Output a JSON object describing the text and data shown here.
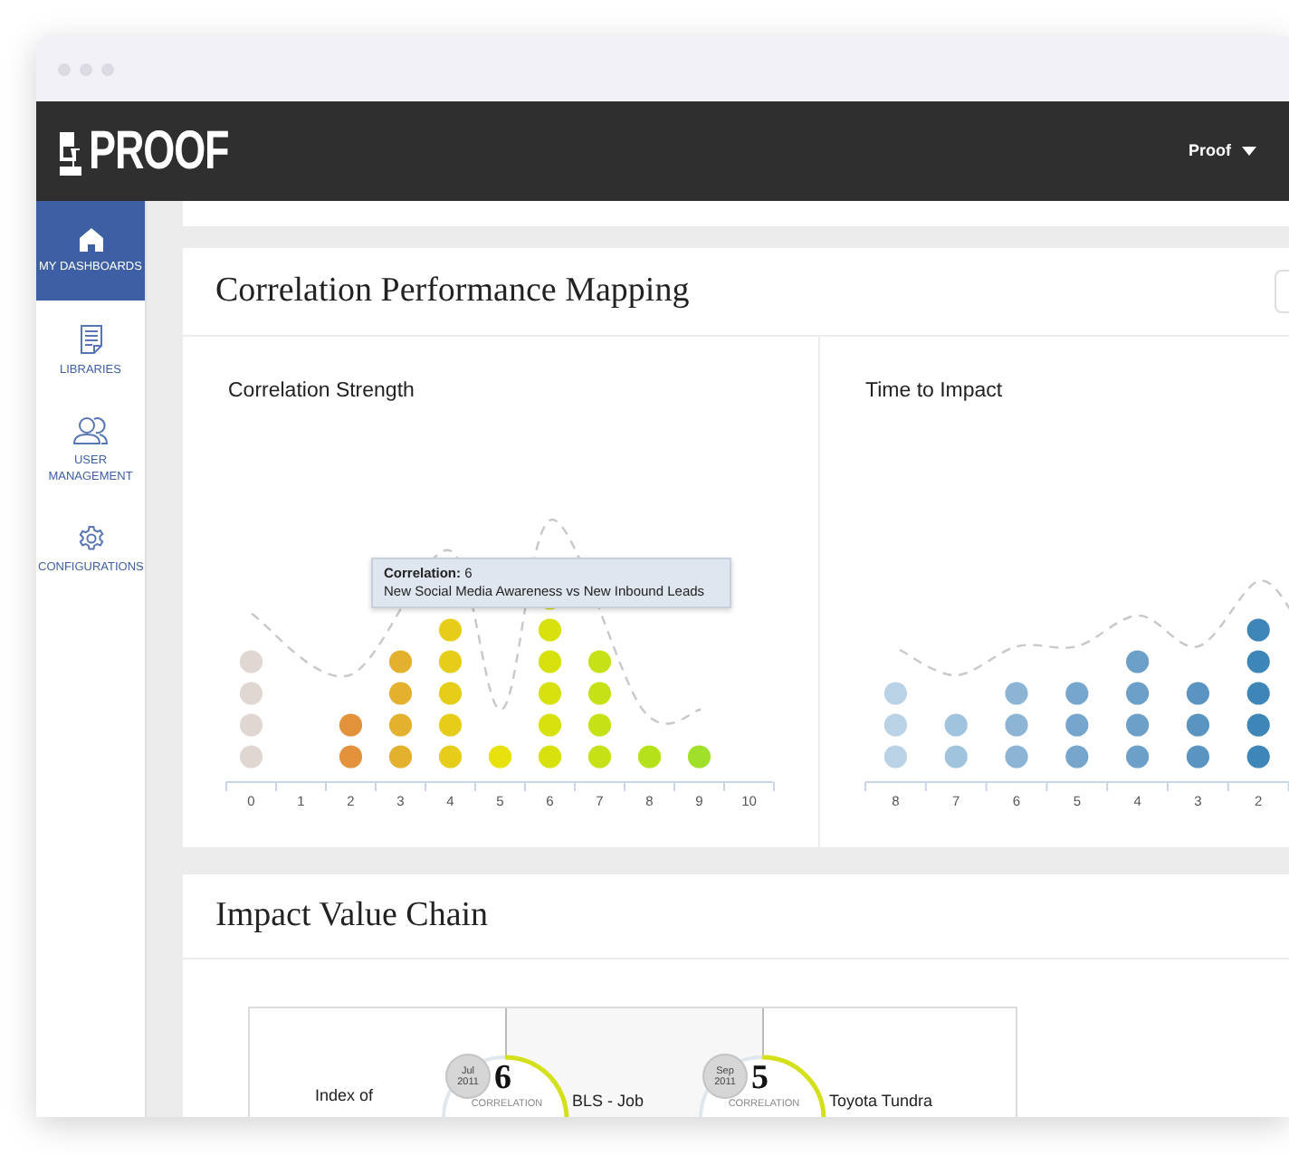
{
  "header": {
    "logo": "PROOF",
    "user_menu": "Proof"
  },
  "sidebar": {
    "items": [
      {
        "kind": "home",
        "label": "MY DASHBOARDS",
        "selected": true
      },
      {
        "kind": "document",
        "label": "LIBRARIES",
        "selected": false
      },
      {
        "kind": "users",
        "label": "USER MANAGEMENT",
        "selected": false
      },
      {
        "kind": "gear",
        "label": "CONFIGURATIONS",
        "selected": false
      }
    ]
  },
  "performance_card": {
    "title": "Correlation Performance Mapping",
    "panels": [
      {
        "title": "Correlation Strength",
        "axis_labels": [
          "0",
          "1",
          "2",
          "3",
          "4",
          "5",
          "6",
          "7",
          "8",
          "9",
          "10"
        ],
        "tooltip": {
          "title": "**Correlation:** 6",
          "text": "New Social Media Awareness vs New Inbound Leads"
        }
      },
      {
        "title": "Time to Impact",
        "axis_labels": [
          "8",
          "7",
          "6",
          "5",
          "4",
          "3",
          "2"
        ]
      }
    ]
  },
  "impact_card": {
    "title": "Impact Value Chain",
    "start_label": "Index of",
    "steps": [
      {
        "month": "Jul",
        "year": "2011",
        "value": "6",
        "caption": "CORRELATION",
        "label": "BLS - Job"
      },
      {
        "month": "Sep",
        "year": "2011",
        "value": "5",
        "caption": "CORRELATION",
        "label": "Toyota Tundra"
      }
    ]
  }
}
